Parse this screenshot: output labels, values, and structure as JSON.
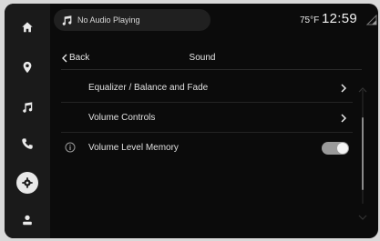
{
  "dock": {
    "items": [
      {
        "icon": "home-icon"
      },
      {
        "icon": "navigation-icon"
      },
      {
        "icon": "music-note-icon"
      },
      {
        "icon": "phone-icon"
      },
      {
        "icon": "settings-icon",
        "active": true
      },
      {
        "icon": "user-icon"
      }
    ]
  },
  "status": {
    "media_text": "No Audio Playing",
    "temperature": "75°F",
    "time": "12:59"
  },
  "header": {
    "back_label": "Back",
    "title": "Sound"
  },
  "settings": {
    "items": [
      {
        "label": "Equalizer / Balance and Fade",
        "type": "submenu"
      },
      {
        "label": "Volume Controls",
        "type": "submenu"
      },
      {
        "label": "Volume Level Memory",
        "type": "toggle",
        "value": true
      }
    ]
  },
  "colors": {
    "background": "#0b0b0b",
    "dock": "#1a1a1a",
    "text": "#e0e0e0",
    "toggle_on": "#9a9a9a"
  }
}
